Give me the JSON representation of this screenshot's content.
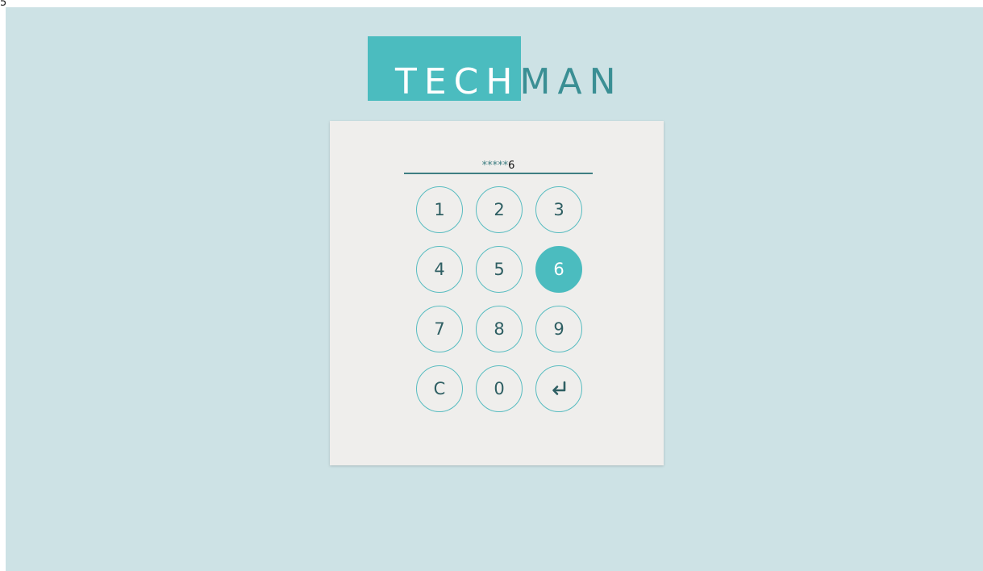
{
  "corner_mark": "5",
  "logo": {
    "part_highlight": "TECH",
    "part_plain": "MAN"
  },
  "pin": {
    "mask": "*****",
    "last_digit": "6"
  },
  "keypad": {
    "keys": [
      "1",
      "2",
      "3",
      "4",
      "5",
      "6",
      "7",
      "8",
      "9",
      "C",
      "0"
    ],
    "enter_icon": "enter-return-icon",
    "active_key": "6"
  },
  "colors": {
    "background": "#cde2e5",
    "accent": "#4bbcbf",
    "card": "#efeeec",
    "text_dark": "#2f5f63"
  }
}
